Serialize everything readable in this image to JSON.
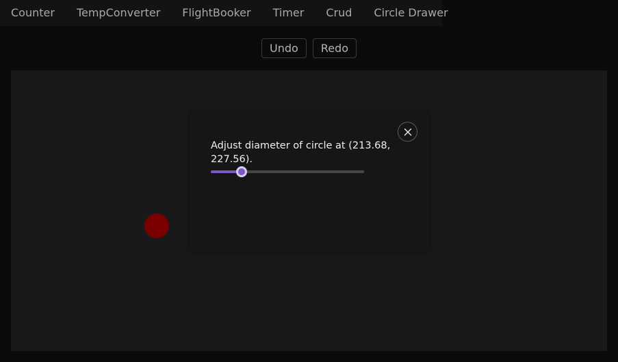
{
  "tabs": [
    {
      "label": "Counter"
    },
    {
      "label": "TempConverter"
    },
    {
      "label": "FlightBooker"
    },
    {
      "label": "Timer"
    },
    {
      "label": "Crud"
    },
    {
      "label": "Circle Drawer"
    }
  ],
  "toolbar": {
    "undo_label": "Undo",
    "redo_label": "Redo"
  },
  "circle": {
    "color": "#7a0000"
  },
  "dialog": {
    "message": "Adjust diameter of circle at (213.68, 227.56).",
    "close_icon": "close-icon",
    "slider": {
      "value_fraction": 0.2,
      "accent": "#7d57c2"
    }
  }
}
